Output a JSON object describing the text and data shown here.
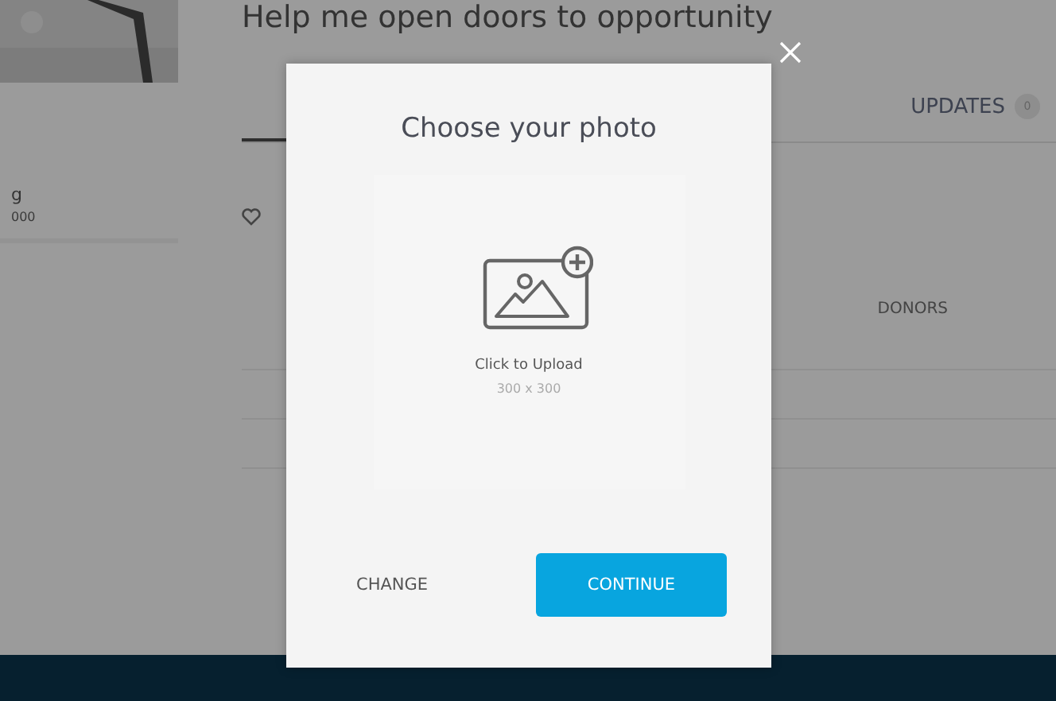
{
  "page": {
    "heading": "Help me open doors to opportunity",
    "campaign_name": "g",
    "campaign_amount": "000",
    "tabs": [
      {
        "label": "UPDATES",
        "count": "0",
        "selected": false
      }
    ],
    "donors_label": "DONORS"
  },
  "dialog": {
    "title": "Choose your photo",
    "upload_label": "Click to Upload",
    "upload_size": "300 x 300",
    "buttons": [
      {
        "label": "CHANGE",
        "kind": "secondary"
      },
      {
        "label": "CONTINUE",
        "kind": "primary"
      }
    ]
  }
}
